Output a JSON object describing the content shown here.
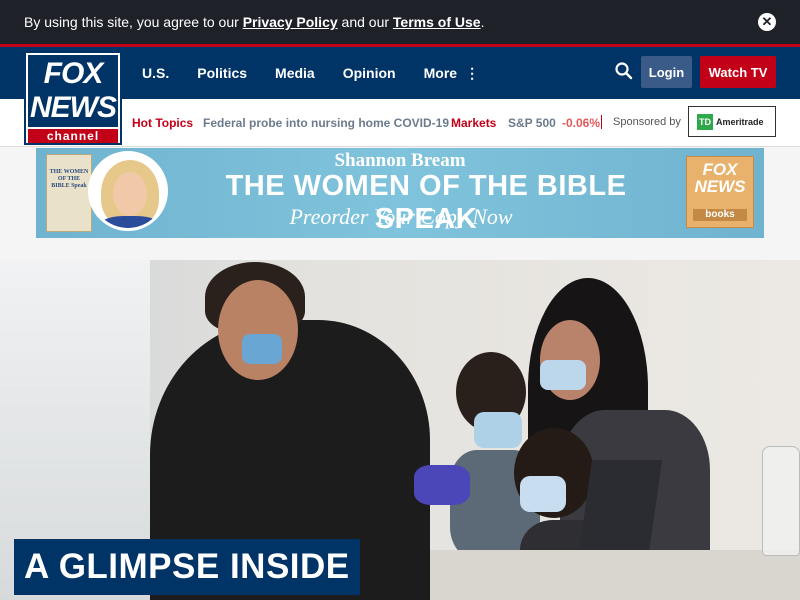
{
  "cookie_banner": {
    "text_before": "By using this site, you agree to our ",
    "privacy_link": "Privacy Policy",
    "text_middle": " and our ",
    "terms_link": "Terms of Use",
    "text_end": ".",
    "close_icon": "close-icon",
    "close_glyph": "✕"
  },
  "logo": {
    "line1": "FOX",
    "line2": "NEWS",
    "line3": "channel"
  },
  "nav": {
    "items": [
      "U.S.",
      "Politics",
      "Media",
      "Opinion",
      "More"
    ],
    "more_glyph": "⋮",
    "search_icon": "search-icon",
    "login_label": "Login",
    "watch_label": "Watch TV"
  },
  "subbar": {
    "hot_topics_label": "Hot Topics",
    "headline": "Federal probe into nursing home COVID-19",
    "markets_label": "Markets",
    "index_name": "S&P 500",
    "index_change": "-0.06%",
    "sponsored_label": "Sponsored by",
    "sponsor_mark": "TD",
    "sponsor_name": "Ameritrade"
  },
  "ad": {
    "author": "Shannon Bream",
    "title": "THE WOMEN OF THE BIBLE SPEAK",
    "cta": "Preorder Your Copy Now",
    "book_cover_text": "THE WOMEN OF THE BIBLE Speak",
    "publisher_line1": "FOX",
    "publisher_line2": "NEWS",
    "publisher_line3": "books"
  },
  "hero": {
    "caption": "A GLIMPSE INSIDE"
  },
  "colors": {
    "brand_navy": "#003366",
    "brand_red": "#c20017",
    "cookie_bg": "#1f2129"
  }
}
